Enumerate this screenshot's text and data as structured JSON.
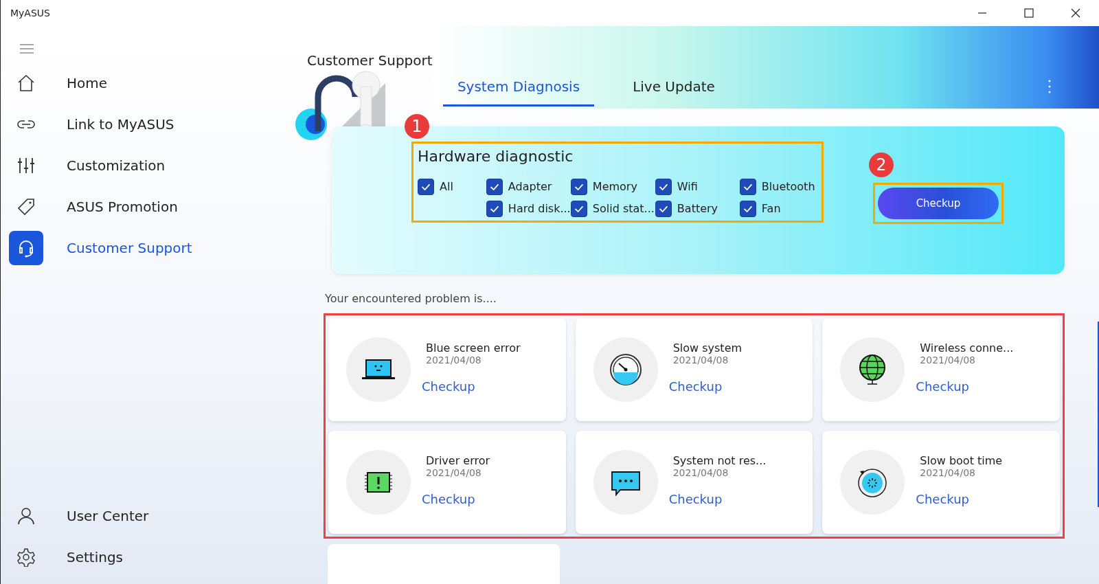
{
  "window": {
    "title": "MyASUS"
  },
  "sidebar": {
    "items": [
      {
        "label": "Home",
        "selected": false
      },
      {
        "label": "Link to MyASUS",
        "selected": false
      },
      {
        "label": "Customization",
        "selected": false
      },
      {
        "label": "ASUS Promotion",
        "selected": false
      },
      {
        "label": "Customer Support",
        "selected": true
      }
    ],
    "bottom_items": [
      {
        "label": "User Center",
        "selected": false
      },
      {
        "label": "Settings",
        "selected": false
      }
    ]
  },
  "header": {
    "title": "Customer Support"
  },
  "tabs": [
    {
      "label": "System Diagnosis",
      "selected": true
    },
    {
      "label": "Live Update",
      "selected": false
    }
  ],
  "diagnostic": {
    "title": "Hardware diagnostic",
    "all": {
      "label": "All",
      "checked": true
    },
    "items": [
      {
        "label": "Adapter",
        "checked": true
      },
      {
        "label": "Memory",
        "checked": true
      },
      {
        "label": "Wifi",
        "checked": true
      },
      {
        "label": "Bluetooth",
        "checked": true
      },
      {
        "label": "Hard disk...",
        "checked": true
      },
      {
        "label": "Solid stat...",
        "checked": true
      },
      {
        "label": "Battery",
        "checked": true
      },
      {
        "label": "Fan",
        "checked": true
      }
    ],
    "badge": "1",
    "button": "Checkup",
    "button_badge": "2"
  },
  "problems": {
    "heading": "Your encountered problem is....",
    "cards": [
      {
        "kind": "laptop",
        "title": "Blue screen error",
        "date": "2021/04/08",
        "action": "Checkup"
      },
      {
        "kind": "gauge",
        "title": "Slow system",
        "date": "2021/04/08",
        "action": "Checkup"
      },
      {
        "kind": "globe",
        "title": "Wireless conne...",
        "date": "2021/04/08",
        "action": "Checkup"
      },
      {
        "kind": "chip",
        "title": "Driver error",
        "date": "2021/04/08",
        "action": "Checkup"
      },
      {
        "kind": "chat",
        "title": "System not res...",
        "date": "2021/04/08",
        "action": "Checkup"
      },
      {
        "kind": "clock",
        "title": "Slow boot time",
        "date": "2021/04/08",
        "action": "Checkup"
      }
    ]
  }
}
